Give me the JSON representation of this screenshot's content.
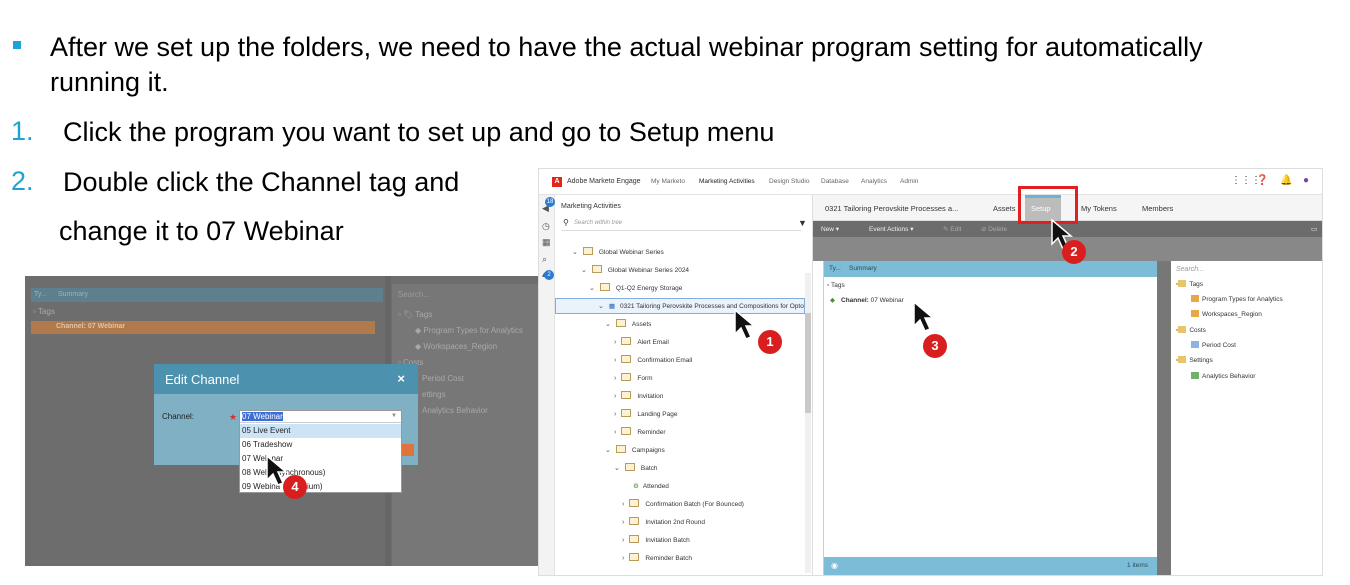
{
  "slide": {
    "line1a": "After we set up the folders, we need to have the actual webinar program setting for automatically",
    "line1b": "running it.",
    "step1_num": "1.",
    "step1": "Click the program you want to set up and go to Setup menu",
    "step2_num": "2.",
    "step2a": "Double click the Channel tag and",
    "step2b": "change it to 07 Webinar"
  },
  "dialog_shot": {
    "header_ty": "Ty...",
    "header_summary": "Summary",
    "tags_label": "Tags",
    "channel_row": "Channel: 07 Webinar",
    "search": "Search...",
    "right_items": [
      "Tags",
      "Program Types for Analytics",
      "Workspaces_Region",
      "Costs",
      "Period Cost",
      "ettings",
      "Analytics Behavior"
    ],
    "modal_title": "Edit Channel",
    "modal_close": "×",
    "channel_label": "Channel:",
    "required": "★",
    "selected_value": "07 Webinar",
    "options": [
      "05 Live Event",
      "06 Tradeshow",
      "07 Webinar",
      "08 Webinar (Asynchronous)",
      "09 Webinar (Symposium)"
    ],
    "options_shown": [
      "05 Live Event",
      "06 Tradeshow",
      "07 Web",
      "nar",
      "08 Web",
      "synchronous)",
      "09 Webina",
      "posium)"
    ]
  },
  "marketo": {
    "brand": "Adobe Marketo Engage",
    "nav": [
      "My Marketo",
      "Marketing Activities",
      "Design Studio",
      "Database",
      "Analytics",
      "Admin"
    ],
    "rail_badges": [
      "18",
      "2"
    ],
    "tree_title": "Marketing Activities",
    "tree_search_placeholder": "Search within tree",
    "tree": [
      "Global Webinar Series",
      "Global Webinar Series 2024",
      "Q1-Q2 Energy Storage",
      "0321 Tailoring Perovskite Processes and Compositions for Opto",
      "Assets",
      "Alert Email",
      "Confirmation Email",
      "Form",
      "Invitation",
      "Landing Page",
      "Reminder",
      "Campaigns",
      "Batch",
      "Attended",
      "Confirmation Batch (For Bounced)",
      "Invitation 2nd Round",
      "Invitation Batch",
      "Reminder Batch"
    ],
    "tabs": [
      "0321 Tailoring Perovskite Processes a...",
      "Assets",
      "Setup",
      "My Tokens",
      "Members"
    ],
    "toolbar": [
      "New ▾",
      "Event Actions ▾",
      "Edit",
      "Delete"
    ],
    "grid_header_ty": "Ty...",
    "grid_header_summary": "Summary",
    "grid_tags": "Tags",
    "grid_channel_label": "Channel:",
    "grid_channel_value": "07 Webinar",
    "grid_footer": "1 items",
    "side_search": "Search...",
    "side_items": [
      "Tags",
      "Program Types for Analytics",
      "Workspaces_Region",
      "Costs",
      "Period Cost",
      "Settings",
      "Analytics Behavior"
    ]
  },
  "callouts": [
    "1",
    "2",
    "3",
    "4"
  ],
  "colors": {
    "accent_blue": "#1aa3d4",
    "callout_red": "#d81e1e",
    "grid_header": "#7cbcd6",
    "modal_header": "#4c91ad"
  }
}
